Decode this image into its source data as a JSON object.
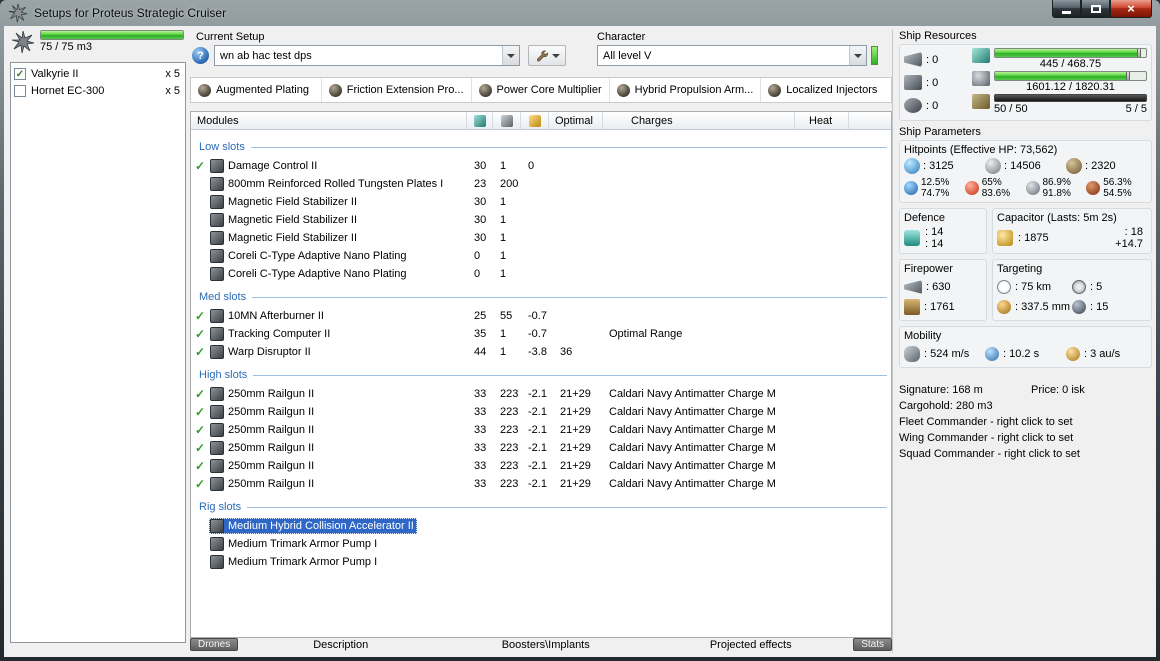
{
  "window": {
    "title": "Setups for Proteus Strategic Cruiser"
  },
  "left_panel": {
    "drone_capacity": "75 / 75 m3",
    "drones": [
      {
        "name": "Valkyrie II",
        "qty": "x 5",
        "checked": true
      },
      {
        "name": "Hornet EC-300",
        "qty": "x 5",
        "checked": false
      }
    ]
  },
  "toolbar": {
    "current_setup_label": "Current Setup",
    "current_setup_value": "wn ab hac test dps",
    "character_label": "Character",
    "character_value": "All level V"
  },
  "subsystems": [
    {
      "label": "Augmented Plating"
    },
    {
      "label": "Friction Extension Pro..."
    },
    {
      "label": "Power Core Multiplier"
    },
    {
      "label": "Hybrid Propulsion Arm..."
    },
    {
      "label": "Localized Injectors"
    }
  ],
  "module_table": {
    "headers": {
      "modules": "Modules",
      "optimal": "Optimal",
      "charges": "Charges",
      "heat": "Heat"
    },
    "sections": [
      {
        "title": "Low slots",
        "rows": [
          {
            "active": true,
            "selected": false,
            "name": "Damage Control II",
            "cpu": "30",
            "pg": "1",
            "cap": "0",
            "optimal": "",
            "charges": ""
          },
          {
            "active": false,
            "selected": false,
            "name": "800mm Reinforced Rolled Tungsten Plates I",
            "cpu": "23",
            "pg": "200",
            "cap": "",
            "optimal": "",
            "charges": ""
          },
          {
            "active": false,
            "selected": false,
            "name": "Magnetic Field Stabilizer II",
            "cpu": "30",
            "pg": "1",
            "cap": "",
            "optimal": "",
            "charges": ""
          },
          {
            "active": false,
            "selected": false,
            "name": "Magnetic Field Stabilizer II",
            "cpu": "30",
            "pg": "1",
            "cap": "",
            "optimal": "",
            "charges": ""
          },
          {
            "active": false,
            "selected": false,
            "name": "Magnetic Field Stabilizer II",
            "cpu": "30",
            "pg": "1",
            "cap": "",
            "optimal": "",
            "charges": ""
          },
          {
            "active": false,
            "selected": false,
            "name": "Coreli C-Type Adaptive Nano Plating",
            "cpu": "0",
            "pg": "1",
            "cap": "",
            "optimal": "",
            "charges": ""
          },
          {
            "active": false,
            "selected": false,
            "name": "Coreli C-Type Adaptive Nano Plating",
            "cpu": "0",
            "pg": "1",
            "cap": "",
            "optimal": "",
            "charges": ""
          }
        ]
      },
      {
        "title": "Med slots",
        "rows": [
          {
            "active": true,
            "selected": false,
            "name": "10MN Afterburner II",
            "cpu": "25",
            "pg": "55",
            "cap": "-0.7",
            "optimal": "",
            "charges": ""
          },
          {
            "active": true,
            "selected": false,
            "name": "Tracking Computer II",
            "cpu": "35",
            "pg": "1",
            "cap": "-0.7",
            "optimal": "",
            "charges": "Optimal Range"
          },
          {
            "active": true,
            "selected": false,
            "name": "Warp Disruptor II",
            "cpu": "44",
            "pg": "1",
            "cap": "-3.8",
            "optimal": "36",
            "charges": ""
          }
        ]
      },
      {
        "title": "High slots",
        "rows": [
          {
            "active": true,
            "selected": false,
            "name": "250mm Railgun II",
            "cpu": "33",
            "pg": "223",
            "cap": "-2.1",
            "optimal": "21+29",
            "charges": "Caldari Navy Antimatter Charge M"
          },
          {
            "active": true,
            "selected": false,
            "name": "250mm Railgun II",
            "cpu": "33",
            "pg": "223",
            "cap": "-2.1",
            "optimal": "21+29",
            "charges": "Caldari Navy Antimatter Charge M"
          },
          {
            "active": true,
            "selected": false,
            "name": "250mm Railgun II",
            "cpu": "33",
            "pg": "223",
            "cap": "-2.1",
            "optimal": "21+29",
            "charges": "Caldari Navy Antimatter Charge M"
          },
          {
            "active": true,
            "selected": false,
            "name": "250mm Railgun II",
            "cpu": "33",
            "pg": "223",
            "cap": "-2.1",
            "optimal": "21+29",
            "charges": "Caldari Navy Antimatter Charge M"
          },
          {
            "active": true,
            "selected": false,
            "name": "250mm Railgun II",
            "cpu": "33",
            "pg": "223",
            "cap": "-2.1",
            "optimal": "21+29",
            "charges": "Caldari Navy Antimatter Charge M"
          },
          {
            "active": true,
            "selected": false,
            "name": "250mm Railgun II",
            "cpu": "33",
            "pg": "223",
            "cap": "-2.1",
            "optimal": "21+29",
            "charges": "Caldari Navy Antimatter Charge M"
          }
        ]
      },
      {
        "title": "Rig slots",
        "rows": [
          {
            "active": false,
            "selected": true,
            "name": "Medium Hybrid Collision Accelerator II",
            "cpu": "",
            "pg": "",
            "cap": "",
            "optimal": "",
            "charges": ""
          },
          {
            "active": false,
            "selected": false,
            "name": "Medium Trimark Armor Pump I",
            "cpu": "",
            "pg": "",
            "cap": "",
            "optimal": "",
            "charges": ""
          },
          {
            "active": false,
            "selected": false,
            "name": "Medium Trimark Armor Pump I",
            "cpu": "",
            "pg": "",
            "cap": "",
            "optimal": "",
            "charges": ""
          }
        ]
      }
    ]
  },
  "bottom_bar": {
    "drones": "Drones",
    "description": "Description",
    "boosters": "Boosters\\Implants",
    "projected": "Projected effects",
    "stats": "Stats"
  },
  "ship_resources": {
    "title": "Ship Resources",
    "hardpoints": [
      {
        "value": ": 0"
      },
      {
        "value": ": 0"
      },
      {
        "value": ": 0"
      }
    ],
    "cpu": {
      "value": "445 / 468.75",
      "pct": 95
    },
    "powergrid": {
      "value": "1601.12 / 1820.31",
      "pct": 88
    },
    "calibration_pct": 100,
    "calibration": "50 / 50",
    "rig_slots": "5 / 5"
  },
  "ship_parameters": {
    "title": "Ship Parameters",
    "hitpoints_label": "Hitpoints (Effective HP: 73,562)",
    "shield_hp": ": 3125",
    "armor_hp": ": 14506",
    "hull_hp": ": 2320",
    "resists": [
      {
        "shield": "12.5%",
        "armor": "74.7%"
      },
      {
        "shield": "65%",
        "armor": "83.6%"
      },
      {
        "shield": "86.9%",
        "armor": "91.8%"
      },
      {
        "shield": "56.3%",
        "armor": "54.5%"
      }
    ],
    "defence": {
      "title": "Defence",
      "v1": ": 14",
      "v2": ": 14"
    },
    "capacitor": {
      "title": "Capacitor (Lasts: 5m 2s)",
      "amount": ": 1875",
      "v2": ": 18",
      "v3": "+14.7"
    },
    "firepower": {
      "title": "Firepower",
      "dps": ": 630",
      "volley": ": 1761"
    },
    "targeting": {
      "title": "Targeting",
      "range": ": 75 km",
      "max_targets": ": 5",
      "scan_res": ": 337.5 mm",
      "sensor": ": 15"
    },
    "mobility": {
      "title": "Mobility",
      "speed": ": 524 m/s",
      "align": ": 10.2 s",
      "warp": ": 3 au/s"
    },
    "signature": "Signature: 168 m",
    "price": "Price: 0 isk",
    "cargohold": "Cargohold: 280 m3",
    "fleet": "Fleet Commander - right click to set",
    "wing": "Wing Commander - right click to set",
    "squad": "Squad Commander - right click to set"
  },
  "drone_bay_pct": 100
}
